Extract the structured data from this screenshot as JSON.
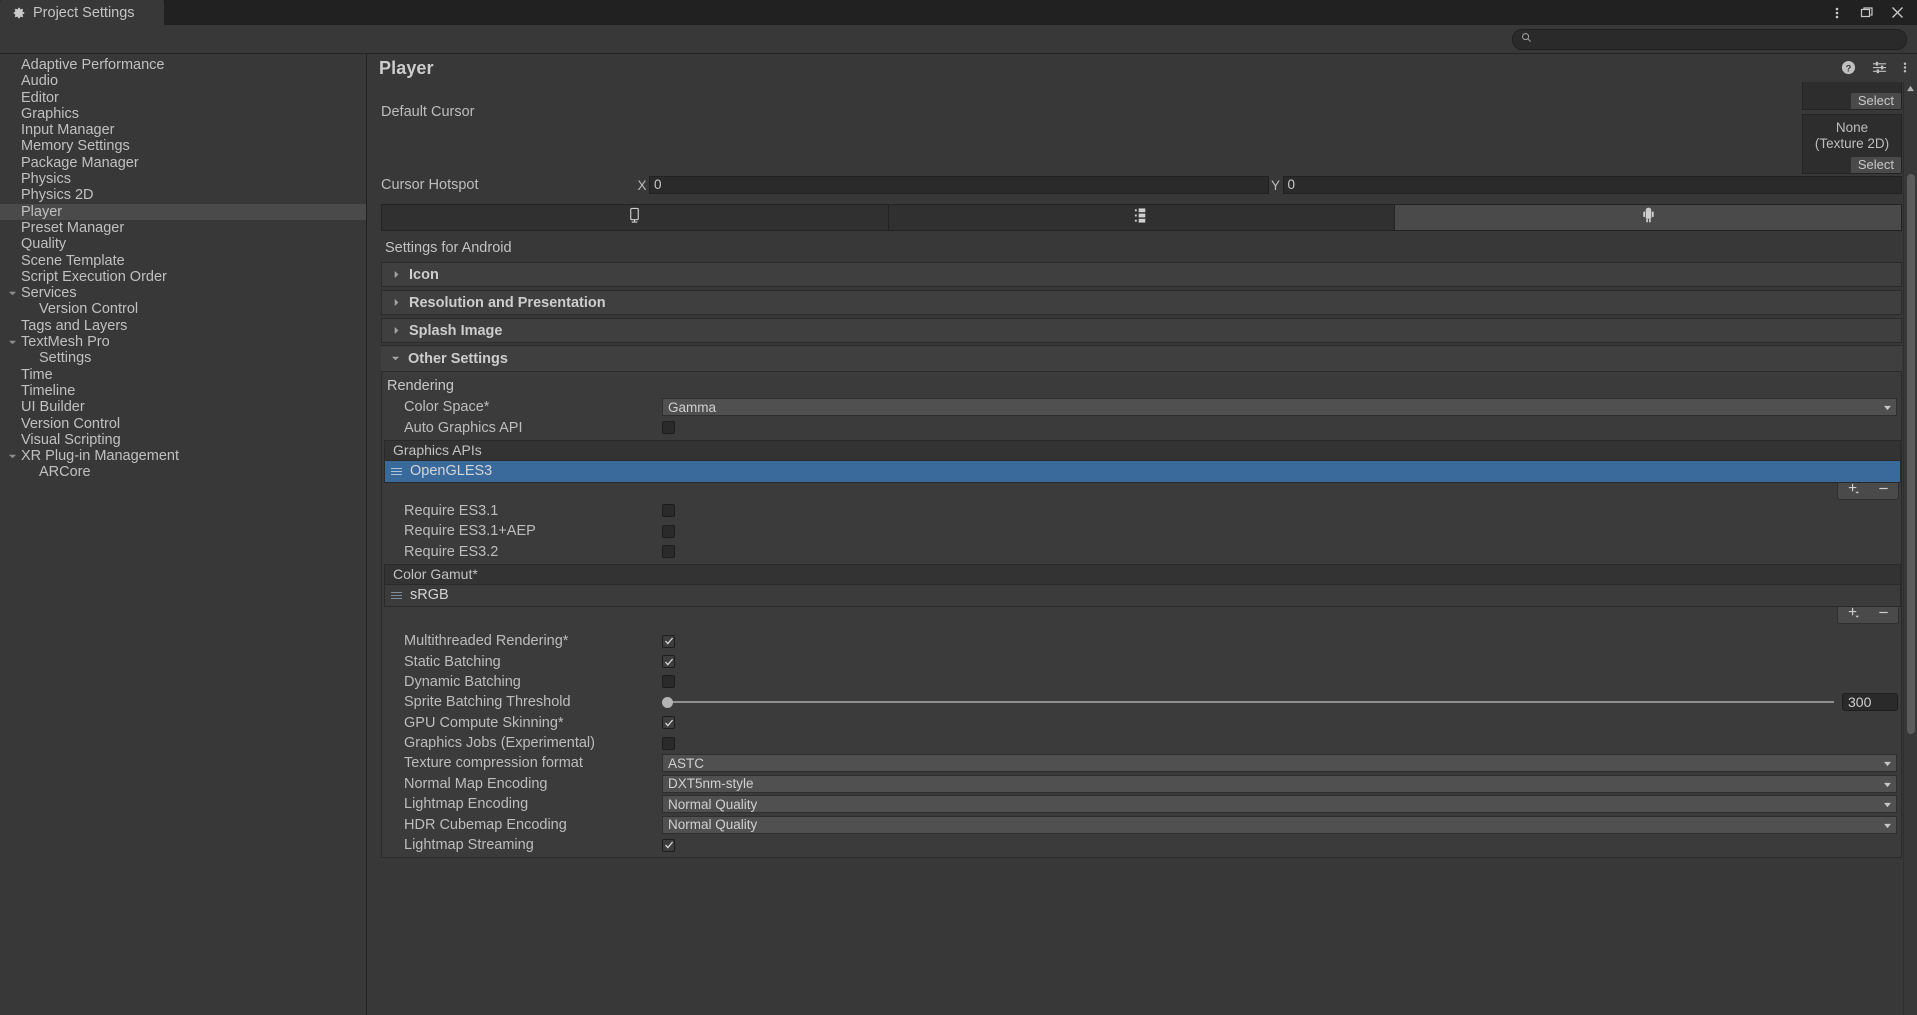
{
  "window": {
    "tab_title": "Project Settings",
    "tab_icon": "gear-icon",
    "controls": [
      {
        "name": "window-menu-button",
        "icon": "kebab-menu-icon"
      },
      {
        "name": "maximize-button",
        "icon": "maximize-icon"
      },
      {
        "name": "close-button",
        "icon": "close-icon"
      }
    ]
  },
  "search": {
    "value": "",
    "placeholder": "",
    "icon": "search-icon"
  },
  "sidebar": {
    "items": [
      {
        "label": "Adaptive Performance",
        "expander": "none",
        "child": false,
        "selected": false
      },
      {
        "label": "Audio",
        "expander": "none",
        "child": false,
        "selected": false
      },
      {
        "label": "Editor",
        "expander": "none",
        "child": false,
        "selected": false
      },
      {
        "label": "Graphics",
        "expander": "none",
        "child": false,
        "selected": false
      },
      {
        "label": "Input Manager",
        "expander": "none",
        "child": false,
        "selected": false
      },
      {
        "label": "Memory Settings",
        "expander": "none",
        "child": false,
        "selected": false
      },
      {
        "label": "Package Manager",
        "expander": "none",
        "child": false,
        "selected": false
      },
      {
        "label": "Physics",
        "expander": "none",
        "child": false,
        "selected": false
      },
      {
        "label": "Physics 2D",
        "expander": "none",
        "child": false,
        "selected": false
      },
      {
        "label": "Player",
        "expander": "none",
        "child": false,
        "selected": true
      },
      {
        "label": "Preset Manager",
        "expander": "none",
        "child": false,
        "selected": false
      },
      {
        "label": "Quality",
        "expander": "none",
        "child": false,
        "selected": false
      },
      {
        "label": "Scene Template",
        "expander": "none",
        "child": false,
        "selected": false
      },
      {
        "label": "Script Execution Order",
        "expander": "none",
        "child": false,
        "selected": false
      },
      {
        "label": "Services",
        "expander": "expanded",
        "child": false,
        "selected": false
      },
      {
        "label": "Version Control",
        "expander": "none",
        "child": true,
        "selected": false
      },
      {
        "label": "Tags and Layers",
        "expander": "none",
        "child": false,
        "selected": false
      },
      {
        "label": "TextMesh Pro",
        "expander": "expanded",
        "child": false,
        "selected": false
      },
      {
        "label": "Settings",
        "expander": "none",
        "child": true,
        "selected": false
      },
      {
        "label": "Time",
        "expander": "none",
        "child": false,
        "selected": false
      },
      {
        "label": "Timeline",
        "expander": "none",
        "child": false,
        "selected": false
      },
      {
        "label": "UI Builder",
        "expander": "none",
        "child": false,
        "selected": false
      },
      {
        "label": "Version Control",
        "expander": "none",
        "child": false,
        "selected": false
      },
      {
        "label": "Visual Scripting",
        "expander": "none",
        "child": false,
        "selected": false
      },
      {
        "label": "XR Plug-in Management",
        "expander": "expanded",
        "child": false,
        "selected": false
      },
      {
        "label": "ARCore",
        "expander": "none",
        "child": true,
        "selected": false
      }
    ]
  },
  "main": {
    "title": "Player",
    "header_icons": [
      {
        "name": "help-icon"
      },
      {
        "name": "preset-icon"
      },
      {
        "name": "kebab-menu-icon"
      }
    ],
    "default_cursor": {
      "label": "Default Cursor",
      "select_label": "Select",
      "value": "None",
      "value_type": "(Texture 2D)",
      "select_label_2": "Select"
    },
    "cursor_hotspot": {
      "label": "Cursor Hotspot",
      "x_axis": "X",
      "x_value": "0",
      "y_axis": "Y",
      "y_value": "0"
    },
    "platform_tabs": [
      {
        "name": "tab-standalone",
        "icon": "desktop-icon",
        "active": false
      },
      {
        "name": "tab-dedicated-server",
        "icon": "server-icon",
        "active": false
      },
      {
        "name": "tab-android",
        "icon": "android-icon",
        "active": true
      }
    ],
    "settings_for": "Settings for Android",
    "foldouts": [
      {
        "label": "Icon",
        "expanded": false
      },
      {
        "label": "Resolution and Presentation",
        "expanded": false
      },
      {
        "label": "Splash Image",
        "expanded": false
      }
    ],
    "other_settings": {
      "label": "Other Settings",
      "expanded": true,
      "groups": [
        {
          "title": "Rendering",
          "rows": [
            {
              "type": "dropdown",
              "label": "Color Space*",
              "value": "Gamma"
            },
            {
              "type": "checkbox",
              "label": "Auto Graphics API",
              "checked": false
            }
          ]
        }
      ],
      "graphics_apis": {
        "header": "Graphics APIs",
        "items": [
          {
            "label": "OpenGLES3",
            "selected": true
          }
        ],
        "add_button": "add-icon",
        "remove_button": "remove-icon"
      },
      "es_rows": [
        {
          "type": "checkbox",
          "label": "Require ES3.1",
          "checked": false
        },
        {
          "type": "checkbox",
          "label": "Require ES3.1+AEP",
          "checked": false
        },
        {
          "type": "checkbox",
          "label": "Require ES3.2",
          "checked": false
        }
      ],
      "color_gamut": {
        "header": "Color Gamut*",
        "items": [
          {
            "label": "sRGB",
            "selected": false
          }
        ],
        "add_button": "add-icon",
        "remove_button": "remove-icon"
      },
      "batching_rows": [
        {
          "type": "checkbox",
          "label": "Multithreaded Rendering*",
          "checked": true
        },
        {
          "type": "checkbox",
          "label": "Static Batching",
          "checked": true
        },
        {
          "type": "checkbox",
          "label": "Dynamic Batching",
          "checked": false
        },
        {
          "type": "slider",
          "label": "Sprite Batching Threshold",
          "value": "300",
          "percent": 0
        },
        {
          "type": "checkbox",
          "label": "GPU Compute Skinning*",
          "checked": true
        },
        {
          "type": "checkbox",
          "label": "Graphics Jobs (Experimental)",
          "checked": false
        },
        {
          "type": "dropdown",
          "label": "Texture compression format",
          "value": "ASTC"
        },
        {
          "type": "dropdown",
          "label": "Normal Map Encoding",
          "value": "DXT5nm-style"
        },
        {
          "type": "dropdown",
          "label": "Lightmap Encoding",
          "value": "Normal Quality"
        },
        {
          "type": "dropdown",
          "label": "HDR Cubemap Encoding",
          "value": "Normal Quality"
        },
        {
          "type": "checkbox",
          "label": "Lightmap Streaming",
          "checked": true
        }
      ]
    }
  }
}
